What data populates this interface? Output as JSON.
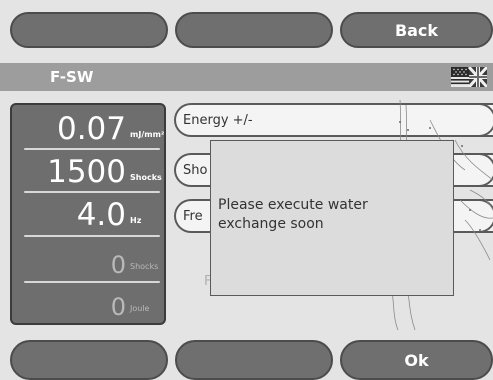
{
  "top_buttons": [
    {
      "label": ""
    },
    {
      "label": ""
    },
    {
      "label": "Back"
    }
  ],
  "title_bar": {
    "title": "F-SW",
    "language_icon": "uk-us-flag-icon"
  },
  "left_panel": {
    "energy": {
      "value": "0.07",
      "unit": "mJ/mm²"
    },
    "shocks": {
      "value": "1500",
      "unit": "Shocks"
    },
    "frequency": {
      "value": "4.0",
      "unit": "Hz"
    },
    "delivered_shocks": {
      "value": "0",
      "unit": "Shocks"
    },
    "delivered_energy": {
      "value": "0",
      "unit": "Joule"
    }
  },
  "options": [
    {
      "label": "Energy +/-"
    },
    {
      "label": "Sho"
    },
    {
      "label": "Fre"
    }
  ],
  "ghost_text": "F",
  "dialog": {
    "message": "Please execute water exchange soon"
  },
  "bottom_buttons": [
    {
      "label": ""
    },
    {
      "label": ""
    },
    {
      "label": "Ok"
    }
  ],
  "colors": {
    "button": "#6f6f6f",
    "title_bar": "#9d9d9d",
    "panel": "#6e6e6e",
    "background": "#e4e4e4"
  }
}
